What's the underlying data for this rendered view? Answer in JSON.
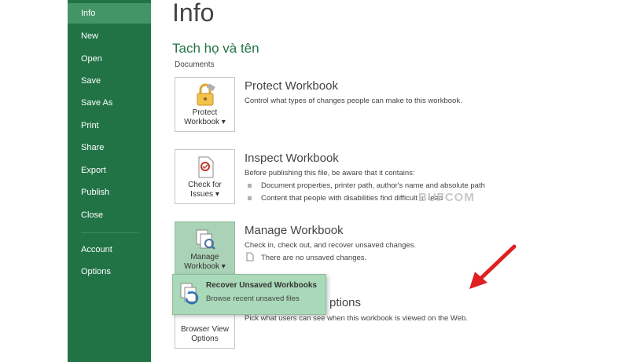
{
  "sidebar": {
    "items": [
      {
        "label": "Info"
      },
      {
        "label": "New"
      },
      {
        "label": "Open"
      },
      {
        "label": "Save"
      },
      {
        "label": "Save As"
      },
      {
        "label": "Print"
      },
      {
        "label": "Share"
      },
      {
        "label": "Export"
      },
      {
        "label": "Publish"
      },
      {
        "label": "Close"
      },
      {
        "label": "Account"
      },
      {
        "label": "Options"
      }
    ]
  },
  "header": {
    "title": "Info"
  },
  "document": {
    "name": "Tach họ và tên",
    "location": "Documents"
  },
  "protect": {
    "button_line1": "Protect",
    "button_line2": "Workbook ▾",
    "title": "Protect Workbook",
    "description": "Control what types of changes people can make to this workbook."
  },
  "inspect": {
    "button_line1": "Check for",
    "button_line2": "Issues ▾",
    "title": "Inspect Workbook",
    "description": "Before publishing this file, be aware that it contains:",
    "bullets": [
      "Document properties, printer path, author's name and absolute path",
      "Content that people with disabilities find difficult to read"
    ]
  },
  "manage": {
    "button_line1": "Manage",
    "button_line2": "Workbook ▾",
    "title": "Manage Workbook",
    "description": "Check in, check out, and recover unsaved changes.",
    "note": "There are no unsaved changes."
  },
  "browser": {
    "button_line1": "Browser View",
    "button_line2": "Options",
    "title_fragment": "ptions",
    "description": "Pick what users can see when this workbook is viewed on the Web."
  },
  "dropdown": {
    "title": "Recover Unsaved Workbooks",
    "subtitle": "Browse recent unsaved files"
  },
  "watermark": "BUFCOM",
  "colors": {
    "sidebar": "#217346",
    "active": "#439467",
    "accent": "#217346",
    "dropdown": "#a9d9b8",
    "arrow": "#e02020"
  }
}
